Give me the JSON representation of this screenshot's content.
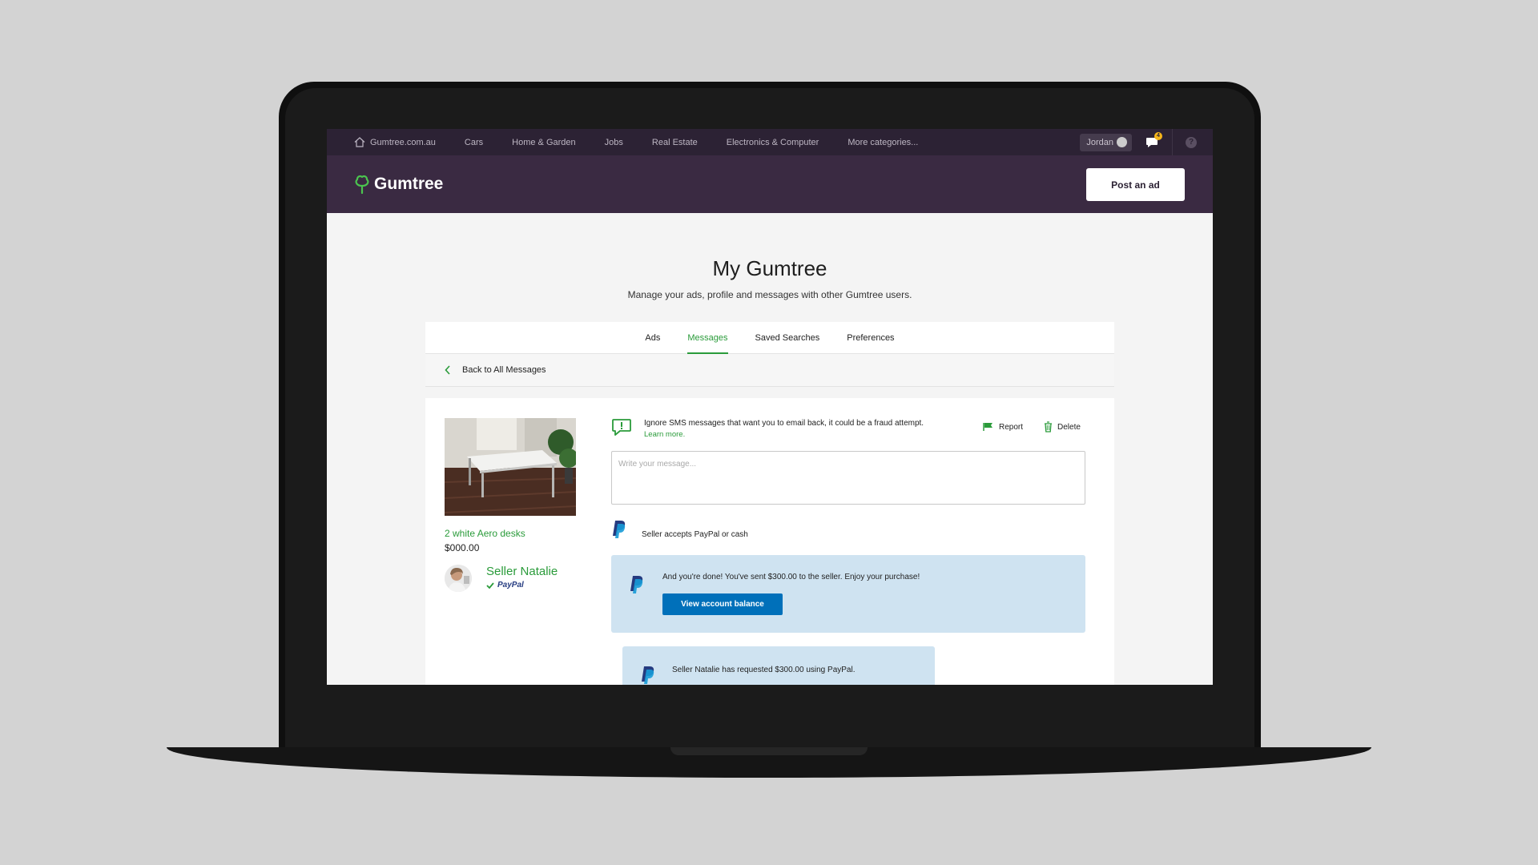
{
  "topnav": {
    "items": [
      {
        "label": "Gumtree.com.au",
        "icon": "home-icon"
      },
      {
        "label": "Cars"
      },
      {
        "label": "Home & Garden"
      },
      {
        "label": "Jobs"
      },
      {
        "label": "Real Estate"
      },
      {
        "label": "Electronics & Computer"
      },
      {
        "label": "More categories..."
      }
    ],
    "user": "Jordan",
    "messages_badge": "4",
    "help": "?"
  },
  "header": {
    "logo_text": "Gumtree",
    "post_label": "Post an ad"
  },
  "main": {
    "title": "My Gumtree",
    "subtitle": "Manage your ads, profile and messages with other Gumtree users.",
    "tabs": [
      {
        "label": "Ads",
        "active": false
      },
      {
        "label": "Messages",
        "active": true
      },
      {
        "label": "Saved Searches",
        "active": false
      },
      {
        "label": "Preferences",
        "active": false
      }
    ],
    "back_label": "Back to All Messages"
  },
  "ad": {
    "title": "2 white Aero desks",
    "price": "$000.00",
    "seller_name": "Seller Natalie",
    "seller_payment": "PayPal"
  },
  "conversation": {
    "warning": "Ignore SMS messages that want you to email back, it could be a fraud attempt.",
    "learn_more": "Learn more.",
    "report_label": "Report",
    "delete_label": "Delete",
    "input_placeholder": "Write your message...",
    "paypal_note": "Seller accepts PayPal or cash",
    "done_message": "And you're done! You've sent $300.00 to the seller. Enjoy your purchase!",
    "done_button": "View account balance",
    "request_message": "Seller Natalie has requested $300.00 using PayPal."
  },
  "colors": {
    "nav_bg": "#2c2234",
    "header_bg": "#3a2a42",
    "accent_green": "#2a9b3a",
    "paypal_blue": "#0070ba",
    "card_blue": "#cfe3f1"
  }
}
